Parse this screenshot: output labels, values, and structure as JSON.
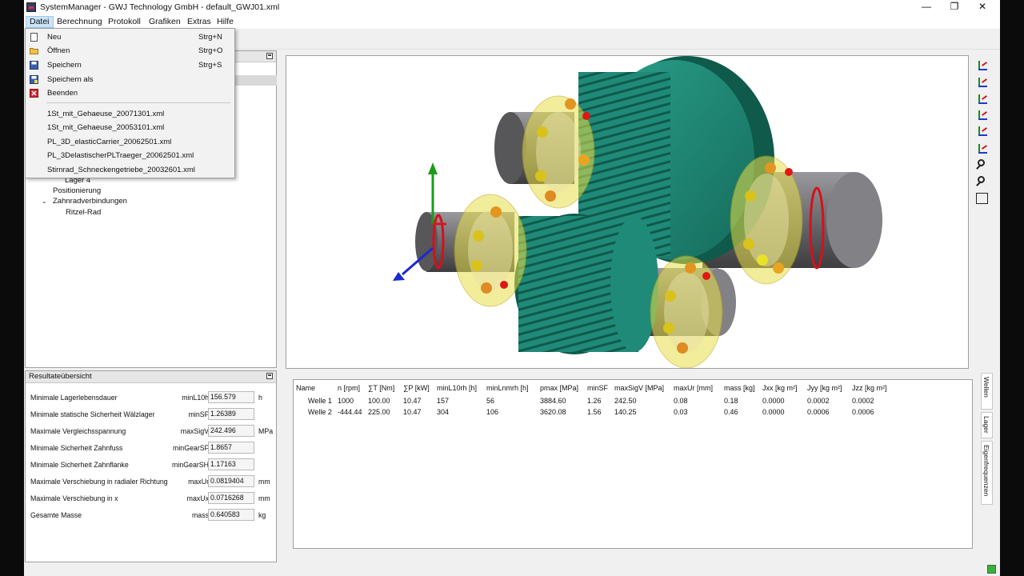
{
  "window": {
    "title": "SystemManager - GWJ Technology GmbH - default_GWJ01.xml",
    "minimize": "—",
    "maximize": "❐",
    "close": "✕"
  },
  "menu": [
    "Datei",
    "Berechnung",
    "Protokoll",
    "Grafiken",
    "Extras",
    "Hilfe"
  ],
  "dropdown": {
    "items": [
      {
        "label": "Neu",
        "shortcut": "Strg+N",
        "icon": "new-file-icon"
      },
      {
        "label": "Öffnen",
        "shortcut": "Strg+O",
        "icon": "folder-icon"
      },
      {
        "label": "Speichern",
        "shortcut": "Strg+S",
        "icon": "save-icon"
      },
      {
        "label": "Speichern als",
        "shortcut": "",
        "icon": "save-as-icon"
      },
      {
        "label": "Beenden",
        "shortcut": "",
        "icon": "exit-icon"
      }
    ],
    "recent": [
      "1St_mit_Gehaeuse_20071301.xml",
      "1St_mit_Gehaeuse_20053101.xml",
      "PL_3D_elasticCarrier_20062501.xml",
      "PL_3DelastischerPLTraeger_20062501.xml",
      "Stirnrad_Schneckengetriebe_20032601.xml"
    ]
  },
  "tree": {
    "items": [
      "Lager 4",
      "Positionierung",
      "Zahnradverbindungen",
      "Ritzel-Rad"
    ]
  },
  "results": {
    "header": "Resultateübersicht",
    "rows": [
      {
        "label": "Minimale Lagerlebensdauer",
        "key": "minL10h",
        "value": "156.579",
        "unit": "h"
      },
      {
        "label": "Minimale statische Sicherheit Wälzlager",
        "key": "minSF",
        "value": "1.26389",
        "unit": ""
      },
      {
        "label": "Maximale Vergleichsspannung",
        "key": "maxSigV",
        "value": "242.496",
        "unit": "MPa"
      },
      {
        "label": "Minimale Sicherheit Zahnfuss",
        "key": "minGearSF",
        "value": "1.8657",
        "unit": ""
      },
      {
        "label": "Minimale Sicherheit Zahnflanke",
        "key": "minGearSH",
        "value": "1.17163",
        "unit": ""
      },
      {
        "label": "Maximale Verschiebung in radialer Richtung",
        "key": "maxUr",
        "value": "0.0819404",
        "unit": "mm"
      },
      {
        "label": "Maximale Verschiebung in x",
        "key": "maxUx",
        "value": "0.0716268",
        "unit": "mm"
      },
      {
        "label": "Gesamte Masse",
        "key": "mass",
        "value": "0.640583",
        "unit": "kg"
      }
    ]
  },
  "table": {
    "headers": [
      "Name",
      "n [rpm]",
      "∑T [Nm]",
      "∑P [kW]",
      "minL10rh [h]",
      "minLnmrh [h]",
      "pmax [MPa]",
      "minSF",
      "maxSigV [MPa]",
      "maxUr [mm]",
      "mass [kg]",
      "Jxx [kg m²]",
      "Jyy [kg m²]",
      "Jzz [kg m²]"
    ],
    "rows": [
      [
        "Welle 1",
        "1000",
        "100.00",
        "10.47",
        "157",
        "56",
        "3884.60",
        "1.26",
        "242.50",
        "0.08",
        "0.18",
        "0.0000",
        "0.0002",
        "0.0002"
      ],
      [
        "Welle 2",
        "-444.44",
        "225.00",
        "10.47",
        "304",
        "106",
        "3620.08",
        "1.56",
        "140.25",
        "0.03",
        "0.46",
        "0.0000",
        "0.0006",
        "0.0006"
      ]
    ]
  },
  "side_tabs": [
    "Wellen",
    "Lager",
    "Eigenfrequenzen"
  ],
  "view_icons": [
    "view-xy-icon",
    "view-xz-icon",
    "view-yz-icon",
    "view-iso-icon",
    "view-rotate-icon",
    "view-axes-icon",
    "zoom-in-icon",
    "zoom-icon",
    "zoom-fit-icon"
  ],
  "colors": {
    "gear": "#1f8a77",
    "shaft": "#6f6f73",
    "bearing": "#e8e04a"
  }
}
